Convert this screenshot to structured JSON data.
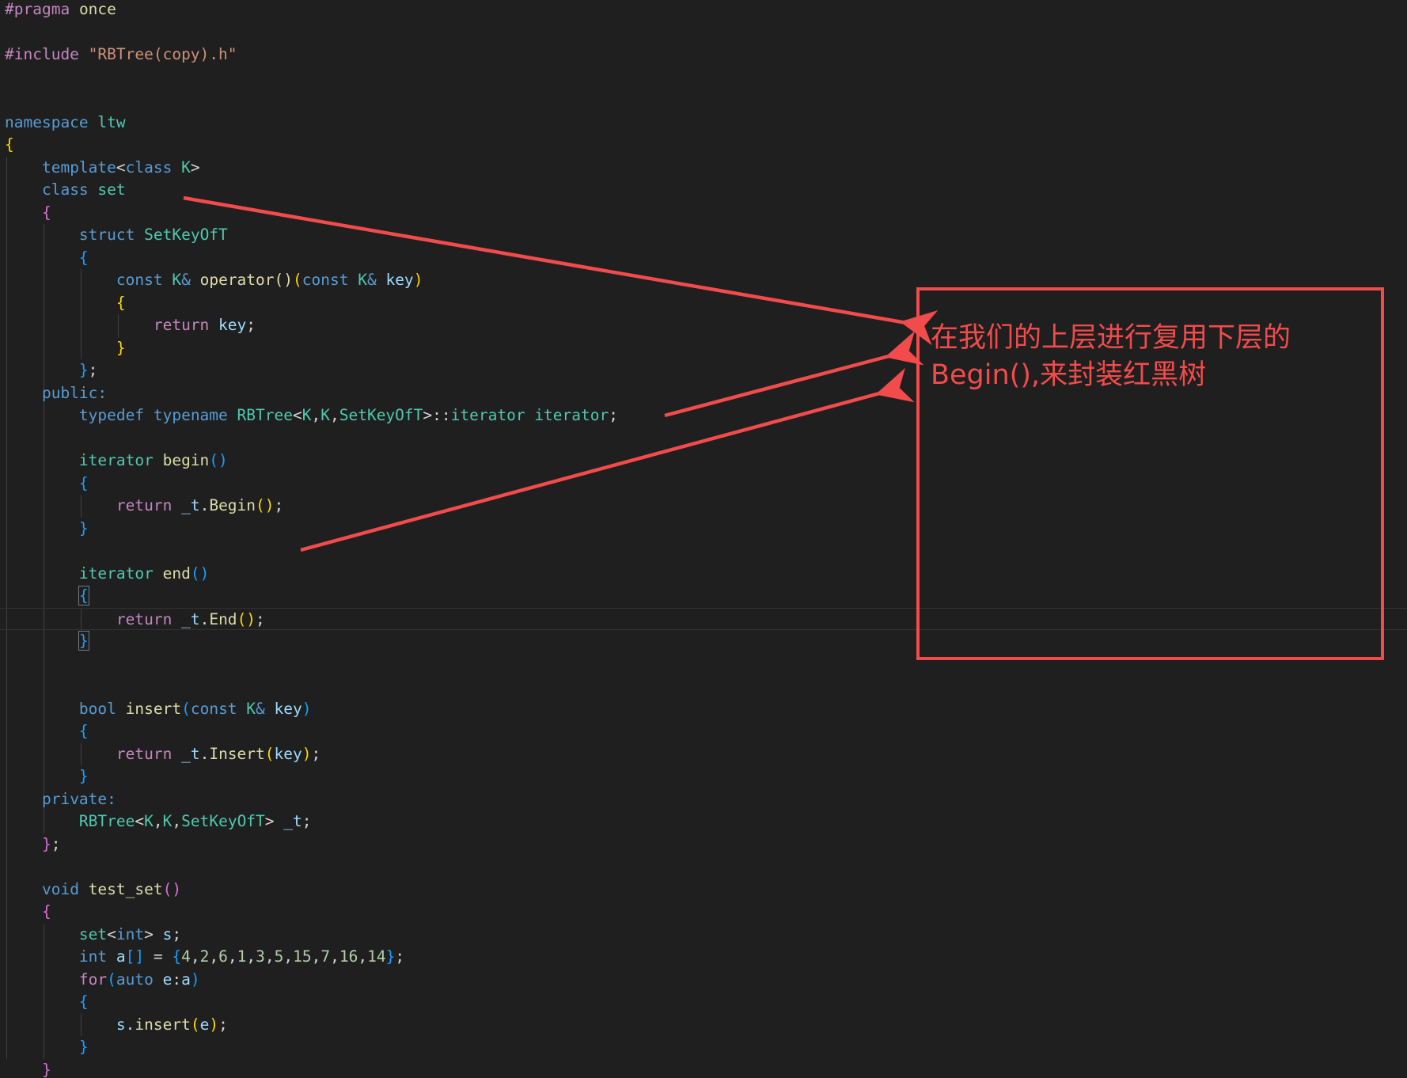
{
  "editor": {
    "lines": [
      [
        {
          "t": "#pragma",
          "c": "directive"
        },
        {
          "t": " "
        },
        {
          "t": "once",
          "c": "func"
        }
      ],
      [],
      [
        {
          "t": "#include",
          "c": "directive"
        },
        {
          "t": " "
        },
        {
          "t": "\"RBTree(copy).h\"",
          "c": "string"
        }
      ],
      [],
      [],
      [
        {
          "t": "namespace",
          "c": "keyword"
        },
        {
          "t": " "
        },
        {
          "t": "ltw",
          "c": "ns"
        }
      ],
      [
        {
          "t": "{",
          "c": "b1"
        }
      ],
      [
        {
          "t": "    "
        },
        {
          "t": "template",
          "c": "keyword"
        },
        {
          "t": "<",
          "c": "plain"
        },
        {
          "t": "class",
          "c": "keyword"
        },
        {
          "t": " "
        },
        {
          "t": "K",
          "c": "type"
        },
        {
          "t": ">",
          "c": "plain"
        }
      ],
      [
        {
          "t": "    "
        },
        {
          "t": "class",
          "c": "keyword"
        },
        {
          "t": " "
        },
        {
          "t": "set",
          "c": "type"
        }
      ],
      [
        {
          "t": "    "
        },
        {
          "t": "{",
          "c": "b2"
        }
      ],
      [
        {
          "t": "        "
        },
        {
          "t": "struct",
          "c": "keyword"
        },
        {
          "t": " "
        },
        {
          "t": "SetKeyOfT",
          "c": "type"
        }
      ],
      [
        {
          "t": "        "
        },
        {
          "t": "{",
          "c": "b3"
        }
      ],
      [
        {
          "t": "            "
        },
        {
          "t": "const",
          "c": "keyword"
        },
        {
          "t": " "
        },
        {
          "t": "K",
          "c": "type"
        },
        {
          "t": "&",
          "c": "keyword"
        },
        {
          "t": " "
        },
        {
          "t": "operator",
          "c": "func"
        },
        {
          "t": "()",
          "c": "func"
        },
        {
          "t": "(",
          "c": "b1"
        },
        {
          "t": "const",
          "c": "keyword"
        },
        {
          "t": " "
        },
        {
          "t": "K",
          "c": "type"
        },
        {
          "t": "&",
          "c": "keyword"
        },
        {
          "t": " "
        },
        {
          "t": "key",
          "c": "var"
        },
        {
          "t": ")",
          "c": "b1"
        }
      ],
      [
        {
          "t": "            "
        },
        {
          "t": "{",
          "c": "b1"
        }
      ],
      [
        {
          "t": "                "
        },
        {
          "t": "return",
          "c": "control"
        },
        {
          "t": " "
        },
        {
          "t": "key",
          "c": "var"
        },
        {
          "t": ";",
          "c": "plain"
        }
      ],
      [
        {
          "t": "            "
        },
        {
          "t": "}",
          "c": "b1"
        }
      ],
      [
        {
          "t": "        "
        },
        {
          "t": "}",
          "c": "b3"
        },
        {
          "t": ";",
          "c": "plain"
        }
      ],
      [
        {
          "t": "    "
        },
        {
          "t": "public:",
          "c": "keyword"
        }
      ],
      [
        {
          "t": "        "
        },
        {
          "t": "typedef",
          "c": "keyword"
        },
        {
          "t": " "
        },
        {
          "t": "typename",
          "c": "keyword"
        },
        {
          "t": " "
        },
        {
          "t": "RBTree",
          "c": "type"
        },
        {
          "t": "<",
          "c": "plain"
        },
        {
          "t": "K",
          "c": "type"
        },
        {
          "t": ",",
          "c": "plain"
        },
        {
          "t": "K",
          "c": "type"
        },
        {
          "t": ",",
          "c": "plain"
        },
        {
          "t": "SetKeyOfT",
          "c": "type"
        },
        {
          "t": ">::",
          "c": "plain"
        },
        {
          "t": "iterator",
          "c": "type"
        },
        {
          "t": " "
        },
        {
          "t": "iterator",
          "c": "type"
        },
        {
          "t": ";",
          "c": "plain"
        }
      ],
      [],
      [
        {
          "t": "        "
        },
        {
          "t": "iterator",
          "c": "type"
        },
        {
          "t": " "
        },
        {
          "t": "begin",
          "c": "func"
        },
        {
          "t": "()",
          "c": "b3"
        }
      ],
      [
        {
          "t": "        "
        },
        {
          "t": "{",
          "c": "b3"
        }
      ],
      [
        {
          "t": "            "
        },
        {
          "t": "return",
          "c": "control"
        },
        {
          "t": " "
        },
        {
          "t": "_t",
          "c": "var"
        },
        {
          "t": ".",
          "c": "plain"
        },
        {
          "t": "Begin",
          "c": "func"
        },
        {
          "t": "()",
          "c": "b1"
        },
        {
          "t": ";",
          "c": "plain"
        }
      ],
      [
        {
          "t": "        "
        },
        {
          "t": "}",
          "c": "b3"
        }
      ],
      [],
      [
        {
          "t": "        "
        },
        {
          "t": "iterator",
          "c": "type"
        },
        {
          "t": " "
        },
        {
          "t": "end",
          "c": "func"
        },
        {
          "t": "()",
          "c": "b3"
        }
      ],
      [
        {
          "t": "        "
        },
        {
          "t": "{",
          "c": "b3",
          "bm": true
        }
      ],
      [
        {
          "t": "            "
        },
        {
          "t": "return",
          "c": "control"
        },
        {
          "t": " "
        },
        {
          "t": "_t",
          "c": "var"
        },
        {
          "t": ".",
          "c": "plain"
        },
        {
          "t": "End",
          "c": "func"
        },
        {
          "t": "()",
          "c": "b1"
        },
        {
          "t": ";",
          "c": "plain"
        }
      ],
      [
        {
          "t": "        "
        },
        {
          "t": "}",
          "c": "b3",
          "bm": true
        }
      ],
      [],
      [],
      [
        {
          "t": "        "
        },
        {
          "t": "bool",
          "c": "keyword"
        },
        {
          "t": " "
        },
        {
          "t": "insert",
          "c": "func"
        },
        {
          "t": "(",
          "c": "b3"
        },
        {
          "t": "const",
          "c": "keyword"
        },
        {
          "t": " "
        },
        {
          "t": "K",
          "c": "type"
        },
        {
          "t": "&",
          "c": "keyword"
        },
        {
          "t": " "
        },
        {
          "t": "key",
          "c": "var"
        },
        {
          "t": ")",
          "c": "b3"
        }
      ],
      [
        {
          "t": "        "
        },
        {
          "t": "{",
          "c": "b3"
        }
      ],
      [
        {
          "t": "            "
        },
        {
          "t": "return",
          "c": "control"
        },
        {
          "t": " "
        },
        {
          "t": "_t",
          "c": "var"
        },
        {
          "t": ".",
          "c": "plain"
        },
        {
          "t": "Insert",
          "c": "func"
        },
        {
          "t": "(",
          "c": "b1"
        },
        {
          "t": "key",
          "c": "var"
        },
        {
          "t": ")",
          "c": "b1"
        },
        {
          "t": ";",
          "c": "plain"
        }
      ],
      [
        {
          "t": "        "
        },
        {
          "t": "}",
          "c": "b3"
        }
      ],
      [
        {
          "t": "    "
        },
        {
          "t": "private:",
          "c": "keyword"
        }
      ],
      [
        {
          "t": "        "
        },
        {
          "t": "RBTree",
          "c": "type"
        },
        {
          "t": "<",
          "c": "plain"
        },
        {
          "t": "K",
          "c": "type"
        },
        {
          "t": ",",
          "c": "plain"
        },
        {
          "t": "K",
          "c": "type"
        },
        {
          "t": ",",
          "c": "plain"
        },
        {
          "t": "SetKeyOfT",
          "c": "type"
        },
        {
          "t": "> ",
          "c": "plain"
        },
        {
          "t": "_t",
          "c": "var"
        },
        {
          "t": ";",
          "c": "plain"
        }
      ],
      [
        {
          "t": "    "
        },
        {
          "t": "}",
          "c": "b2"
        },
        {
          "t": ";",
          "c": "plain"
        }
      ],
      [],
      [
        {
          "t": "    "
        },
        {
          "t": "void",
          "c": "keyword"
        },
        {
          "t": " "
        },
        {
          "t": "test_set",
          "c": "func"
        },
        {
          "t": "()",
          "c": "b2"
        }
      ],
      [
        {
          "t": "    "
        },
        {
          "t": "{",
          "c": "b2"
        }
      ],
      [
        {
          "t": "        "
        },
        {
          "t": "set",
          "c": "type"
        },
        {
          "t": "<",
          "c": "plain"
        },
        {
          "t": "int",
          "c": "keyword"
        },
        {
          "t": ">",
          "c": "plain"
        },
        {
          "t": " "
        },
        {
          "t": "s",
          "c": "var"
        },
        {
          "t": ";",
          "c": "plain"
        }
      ],
      [
        {
          "t": "        "
        },
        {
          "t": "int",
          "c": "keyword"
        },
        {
          "t": " "
        },
        {
          "t": "a",
          "c": "var"
        },
        {
          "t": "[]",
          "c": "b3"
        },
        {
          "t": " = ",
          "c": "plain"
        },
        {
          "t": "{",
          "c": "b3"
        },
        {
          "t": "4",
          "c": "num"
        },
        {
          "t": ",",
          "c": "plain"
        },
        {
          "t": "2",
          "c": "num"
        },
        {
          "t": ",",
          "c": "plain"
        },
        {
          "t": "6",
          "c": "num"
        },
        {
          "t": ",",
          "c": "plain"
        },
        {
          "t": "1",
          "c": "num"
        },
        {
          "t": ",",
          "c": "plain"
        },
        {
          "t": "3",
          "c": "num"
        },
        {
          "t": ",",
          "c": "plain"
        },
        {
          "t": "5",
          "c": "num"
        },
        {
          "t": ",",
          "c": "plain"
        },
        {
          "t": "15",
          "c": "num"
        },
        {
          "t": ",",
          "c": "plain"
        },
        {
          "t": "7",
          "c": "num"
        },
        {
          "t": ",",
          "c": "plain"
        },
        {
          "t": "16",
          "c": "num"
        },
        {
          "t": ",",
          "c": "plain"
        },
        {
          "t": "14",
          "c": "num"
        },
        {
          "t": "}",
          "c": "b3"
        },
        {
          "t": ";",
          "c": "plain"
        }
      ],
      [
        {
          "t": "        "
        },
        {
          "t": "for",
          "c": "control"
        },
        {
          "t": "(",
          "c": "b3"
        },
        {
          "t": "auto",
          "c": "keyword"
        },
        {
          "t": " "
        },
        {
          "t": "e",
          "c": "var"
        },
        {
          "t": ":",
          "c": "plain"
        },
        {
          "t": "a",
          "c": "var"
        },
        {
          "t": ")",
          "c": "b3"
        }
      ],
      [
        {
          "t": "        "
        },
        {
          "t": "{",
          "c": "b3"
        }
      ],
      [
        {
          "t": "            "
        },
        {
          "t": "s",
          "c": "var"
        },
        {
          "t": ".",
          "c": "plain"
        },
        {
          "t": "insert",
          "c": "func"
        },
        {
          "t": "(",
          "c": "b1"
        },
        {
          "t": "e",
          "c": "var"
        },
        {
          "t": ")",
          "c": "b1"
        },
        {
          "t": ";",
          "c": "plain"
        }
      ],
      [
        {
          "t": "        "
        },
        {
          "t": "}",
          "c": "b3"
        }
      ],
      [
        {
          "t": "    "
        },
        {
          "t": "}",
          "c": "b2"
        }
      ]
    ],
    "current_line": 27,
    "colors": {
      "background": "#1f1f1f",
      "annotation": "#f24b4b"
    }
  },
  "annotation": {
    "text_line1": "在我们的上层进行复用下层的",
    "text_line2": "Begin(),来封装红黑树"
  }
}
